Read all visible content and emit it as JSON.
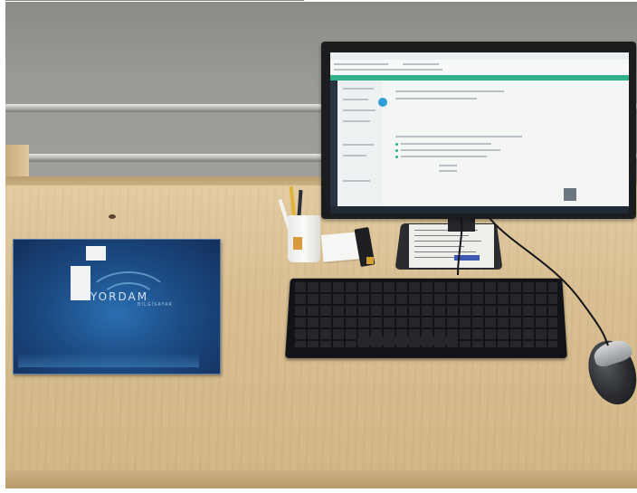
{
  "scene": {
    "description_labels": {
      "folder_logo": "YORDAM",
      "folder_logo_sub": "BİLGİSAYAR"
    },
    "colors": {
      "wall": "#9a9995",
      "desk": "#d9bf93",
      "folder_blue": "#1c4d86",
      "monitor_frame": "#1b1c1e",
      "app_accent": "#2fb18a",
      "keyboard": "#121316",
      "mouse": "#2a2c30"
    },
    "objects": [
      "wall-rail",
      "desk",
      "blue-folder",
      "computer-monitor",
      "monitor-stand",
      "handwritten-note",
      "pen-holder-cup",
      "sticky-note-pad",
      "usb-device",
      "keyboard",
      "mouse",
      "mouse-cable",
      "keyboard-cable"
    ]
  }
}
